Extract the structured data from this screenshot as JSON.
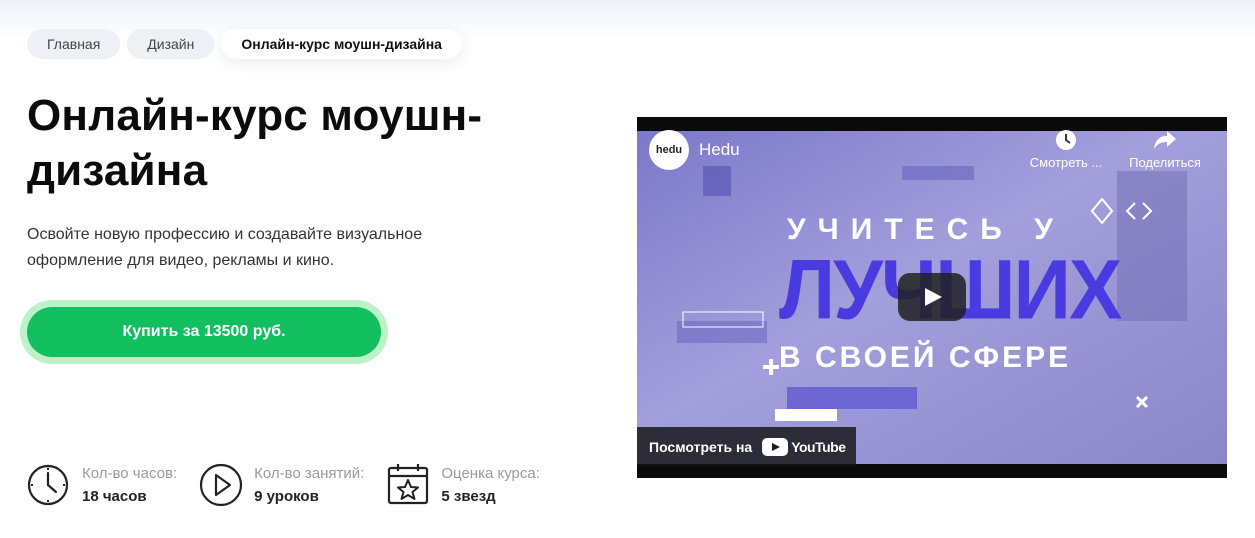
{
  "breadcrumb": {
    "items": [
      "Главная",
      "Дизайн"
    ],
    "current": "Онлайн-курс моушн-дизайна"
  },
  "course": {
    "title_line1": "Онлайн-курс моушн-",
    "title_line2": "дизайна",
    "subtitle_line1": "Освойте новую профессию и создавайте визуальное",
    "subtitle_line2": "оформление для видео, рекламы и кино.",
    "buy_label": "Купить за 13500 руб."
  },
  "stats": [
    {
      "label": "Кол-во часов:",
      "value": "18 часов",
      "icon": "clock-icon"
    },
    {
      "label": "Кол-во занятий:",
      "value": "9 уроков",
      "icon": "play-circle-icon"
    },
    {
      "label": "Оценка курса:",
      "value": "5 звезд",
      "icon": "calendar-star-icon"
    }
  ],
  "video": {
    "channel_logo_text": "hedu",
    "channel_name": "Hedu",
    "watch_later_label": "Смотреть ...",
    "share_label": "Поделиться",
    "thumb_line1": "УЧИТЕСЬ У",
    "thumb_line2": "ЛУЧШИХ",
    "thumb_line3": "В СВОЕЙ СФЕРЕ",
    "watch_on_label": "Посмотреть на",
    "youtube_label": "YouTube"
  },
  "colors": {
    "accent_green": "#12bf5f",
    "accent_green_glow": "#bdf2c8",
    "video_purple": "#4a3be0"
  }
}
